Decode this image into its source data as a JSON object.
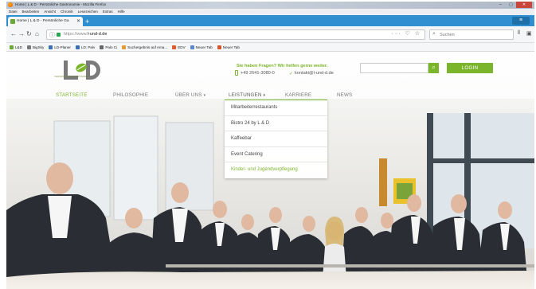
{
  "browser": {
    "window_title": "Home | L & D - Persönliche Gastronomie - Mozilla Firefox",
    "menu": [
      "Datei",
      "Bearbeiten",
      "Ansicht",
      "Chronik",
      "Lesezeichen",
      "Extras",
      "Hilfe"
    ],
    "tab": {
      "title": "Home | L & D - Persönliche Ga",
      "close": "✕"
    },
    "new_tab": "+",
    "url_prefix": "https://www.",
    "url_host": "l-und-d.de",
    "url_actions": "··· ♡ ☆",
    "search_placeholder": "Suchen",
    "bookmarks": [
      {
        "label": "L&D",
        "color": "#6aa836"
      },
      {
        "label": "BigSky",
        "color": "#777777"
      },
      {
        "label": "LD-Planer",
        "color": "#3a6fb5"
      },
      {
        "label": "LD: Palv",
        "color": "#3a6fb5"
      },
      {
        "label": "Palo Ci",
        "color": "#666666"
      },
      {
        "label": "Suchergebnis auf Ama...",
        "color": "#e79b2f"
      },
      {
        "label": "EDV",
        "color": "#e0582b"
      },
      {
        "label": "Neuer Tab",
        "color": "#5a87d0"
      },
      {
        "label": "Neuer Tab",
        "color": "#d9532a"
      }
    ]
  },
  "site": {
    "logo_text": "PERSÖNLICHE GASTRONOMIE",
    "contact_question": "Sie haben Fragen? Wir helfen gerne weiter.",
    "phone": "+49 2641-3080-0",
    "email": "kontakt@l-und-d.de",
    "login": "LOGIN",
    "nav": [
      {
        "label": "STARTSEITE",
        "active": true
      },
      {
        "label": "PHILOSOPHIE"
      },
      {
        "label": "ÜBER UNS"
      },
      {
        "label": "LEISTUNGEN"
      },
      {
        "label": "KARRIERE"
      },
      {
        "label": "NEWS"
      }
    ],
    "dropdown": [
      "Mitarbeiterrestaurants",
      "Bistro 24 by L & D",
      "Kaffeebar",
      "Event Catering",
      "Kinder- und Jugendverpflegung"
    ]
  },
  "colors": {
    "brand_green": "#7bb52b",
    "firefox_blue": "#2f8fd1"
  }
}
